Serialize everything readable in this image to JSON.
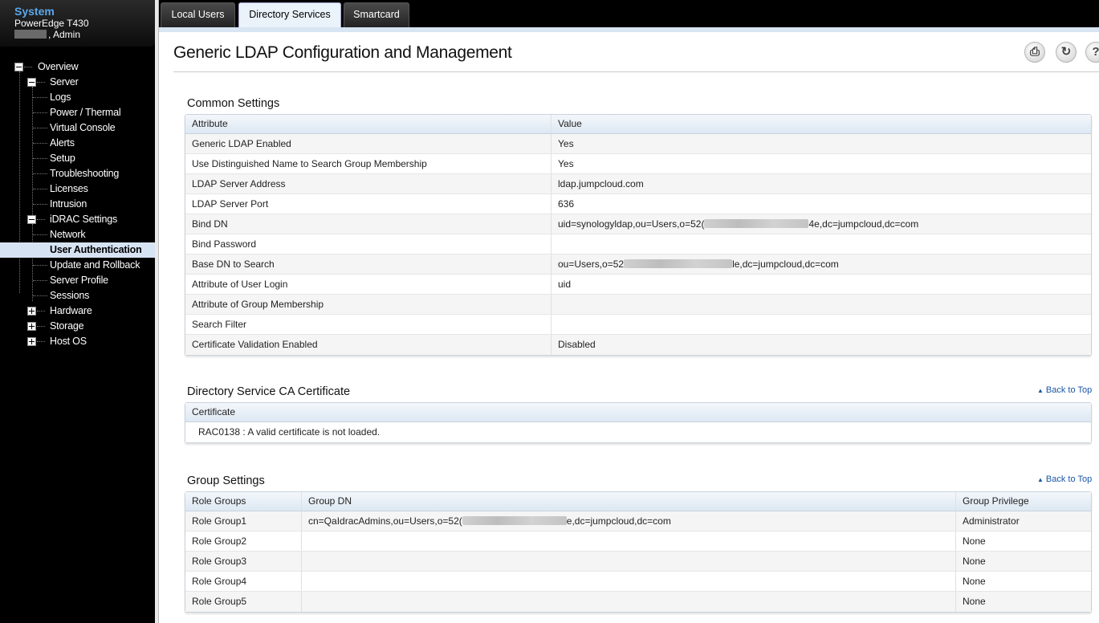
{
  "system": {
    "title": "System",
    "model": "PowerEdge T430",
    "user": ", Admin"
  },
  "tree": {
    "overview": "Overview",
    "server": "Server",
    "logs": "Logs",
    "power": "Power / Thermal",
    "virtual_console": "Virtual Console",
    "alerts": "Alerts",
    "setup": "Setup",
    "troubleshooting": "Troubleshooting",
    "licenses": "Licenses",
    "intrusion": "Intrusion",
    "idrac_settings": "iDRAC Settings",
    "network": "Network",
    "user_auth": "User Authentication",
    "update": "Update and Rollback",
    "server_profile": "Server Profile",
    "sessions": "Sessions",
    "hardware": "Hardware",
    "storage": "Storage",
    "host_os": "Host OS"
  },
  "tabs": [
    "Local Users",
    "Directory Services",
    "Smartcard"
  ],
  "page_title": "Generic LDAP Configuration and Management",
  "toolbar": {
    "print_icon": "print-icon",
    "refresh_icon": "refresh-icon",
    "help_icon": "help-icon"
  },
  "common": {
    "title": "Common Settings",
    "headers": [
      "Attribute",
      "Value"
    ],
    "rows": [
      [
        "Generic LDAP Enabled",
        "Yes"
      ],
      [
        "Use Distinguished Name to Search Group Membership",
        "Yes"
      ],
      [
        "LDAP Server Address",
        "ldap.jumpcloud.com"
      ],
      [
        "LDAP Server Port",
        "636"
      ],
      [
        "Bind DN",
        "uid=synologyldap,ou=Users,o=52(",
        "4e,dc=jumpcloud,dc=com"
      ],
      [
        "Bind Password",
        ""
      ],
      [
        "Base DN to Search",
        "ou=Users,o=52",
        "le,dc=jumpcloud,dc=com"
      ],
      [
        "Attribute of User Login",
        "uid"
      ],
      [
        "Attribute of Group Membership",
        ""
      ],
      [
        "Search Filter",
        ""
      ],
      [
        "Certificate Validation Enabled",
        "Disabled"
      ]
    ]
  },
  "back_to_top": "Back to Top",
  "ca": {
    "title": "Directory Service CA Certificate",
    "header": "Certificate",
    "message": "RAC0138 : A valid certificate is not loaded."
  },
  "groups": {
    "title": "Group Settings",
    "headers": [
      "Role Groups",
      "Group DN",
      "Group Privilege"
    ],
    "rows": [
      [
        "Role Group1",
        "cn=QaIdracAdmins,ou=Users,o=52(",
        "e,dc=jumpcloud,dc=com",
        "Administrator"
      ],
      [
        "Role Group2",
        "",
        "",
        "None"
      ],
      [
        "Role Group3",
        "",
        "",
        "None"
      ],
      [
        "Role Group4",
        "",
        "",
        "None"
      ],
      [
        "Role Group5",
        "",
        "",
        "None"
      ]
    ]
  }
}
